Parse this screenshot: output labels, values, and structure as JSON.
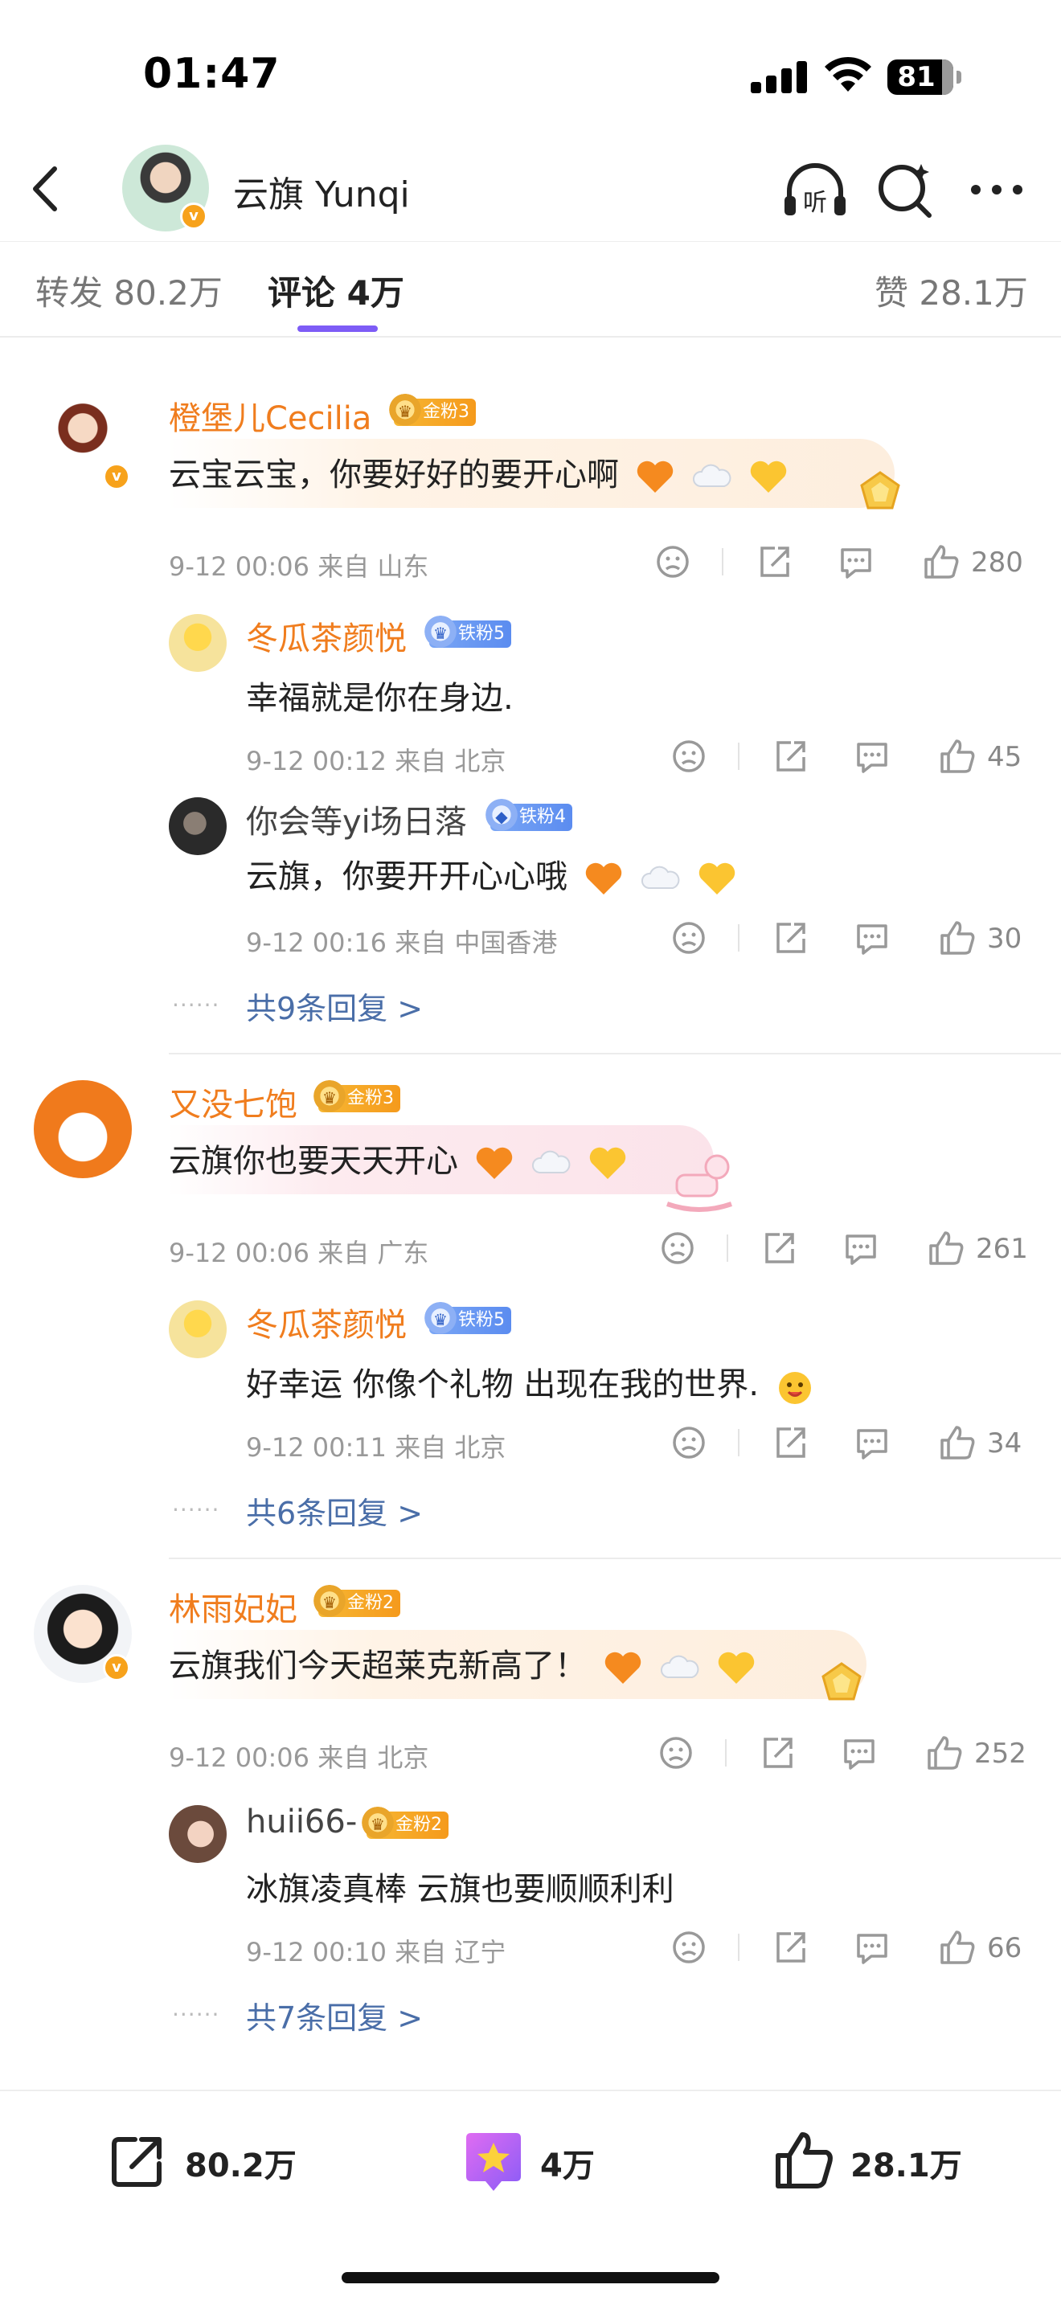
{
  "status_bar": {
    "time": "01:47",
    "battery": "81"
  },
  "header": {
    "title": "云旗 Yunqi",
    "listen_icon": "listen-icon",
    "search_icon": "search-icon",
    "more_icon": "more-icon"
  },
  "tabs": [
    {
      "label": "转发 80.2万"
    },
    {
      "label": "评论 4万"
    },
    {
      "label": "赞 28.1万"
    }
  ],
  "comments": [
    {
      "user": "橙堡儿Cecilia",
      "badge": "金粉3",
      "text": "云宝云宝，你要好好的要开心啊",
      "meta": "9-12 00:06 来自 山东",
      "likes": "280",
      "replies": [
        {
          "user": "冬瓜茶颜悦",
          "badge": "铁粉5",
          "text": "幸福就是你在身边.",
          "meta": "9-12 00:12 来自 北京",
          "likes": "45"
        },
        {
          "user": "你会等yi场日落",
          "badge": "铁粉4",
          "text": "云旗，你要开开心心哦",
          "meta": "9-12 00:16 来自 中国香港",
          "likes": "30"
        }
      ],
      "more": "共9条回复 >"
    },
    {
      "user": "又没七饱",
      "badge": "金粉3",
      "text": "云旗你也要天天开心",
      "meta": "9-12 00:06 来自 广东",
      "likes": "261",
      "replies": [
        {
          "user": "冬瓜茶颜悦",
          "badge": "铁粉5",
          "text": "好幸运 你像个礼物 出现在我的世界.",
          "meta": "9-12 00:11 来自 北京",
          "likes": "34"
        }
      ],
      "more": "共6条回复 >"
    },
    {
      "user": "林雨妃妃",
      "badge": "金粉2",
      "text": "云旗我们今天超莱克新高了！",
      "meta": "9-12 00:06 来自 北京",
      "likes": "252",
      "replies": [
        {
          "user": "huii66-",
          "badge": "金粉2",
          "text": "冰旗凌真棒 云旗也要顺顺利利",
          "meta": "9-12 00:10 来自 辽宁",
          "likes": "66"
        }
      ],
      "more": "共7条回复 >"
    }
  ],
  "bottom_bar": {
    "repost": "80.2万",
    "comment": "4万",
    "like": "28.1万"
  },
  "colors": {
    "accent": "#7d5cf6",
    "username": "#f07d1e",
    "link": "#4a6ea8"
  }
}
